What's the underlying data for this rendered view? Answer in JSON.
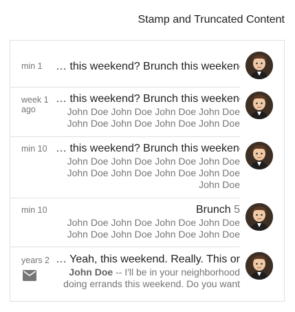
{
  "header": {
    "title": "Stamp and Truncated Content"
  },
  "items": [
    {
      "stamp": "min 1",
      "primary": "… this weekend? Brunch this weekend",
      "secondary": "",
      "avatar": "avatar-icon"
    },
    {
      "stamp": "week 1 ago",
      "primary": "… this weekend? Brunch this weekend",
      "secondary": "John Doe John Doe John Doe John Doe John Doe John Doe John Doe John Doe",
      "avatar": "avatar-icon"
    },
    {
      "stamp": "min 10",
      "primary": "… this weekend? Brunch this weekend",
      "secondary": "John Doe John Doe John Doe John Doe John Doe John Doe John Doe John Doe John Doe",
      "avatar": "avatar-icon"
    },
    {
      "stamp": "min 10",
      "primary": "Brunch",
      "count": "5",
      "secondary": "John Doe John Doe John Doe John Doe John Doe John Doe John Doe John Doe",
      "avatar": "avatar-icon"
    },
    {
      "stamp": "years 2",
      "primary": "… Yeah, this weekend. Really. This one",
      "secondary_sender": "John Doe",
      "secondary": "-- I'll be in your neighborhood doing errands this weekend. Do you want",
      "icon": "mail-icon",
      "avatar": "avatar-icon"
    }
  ]
}
